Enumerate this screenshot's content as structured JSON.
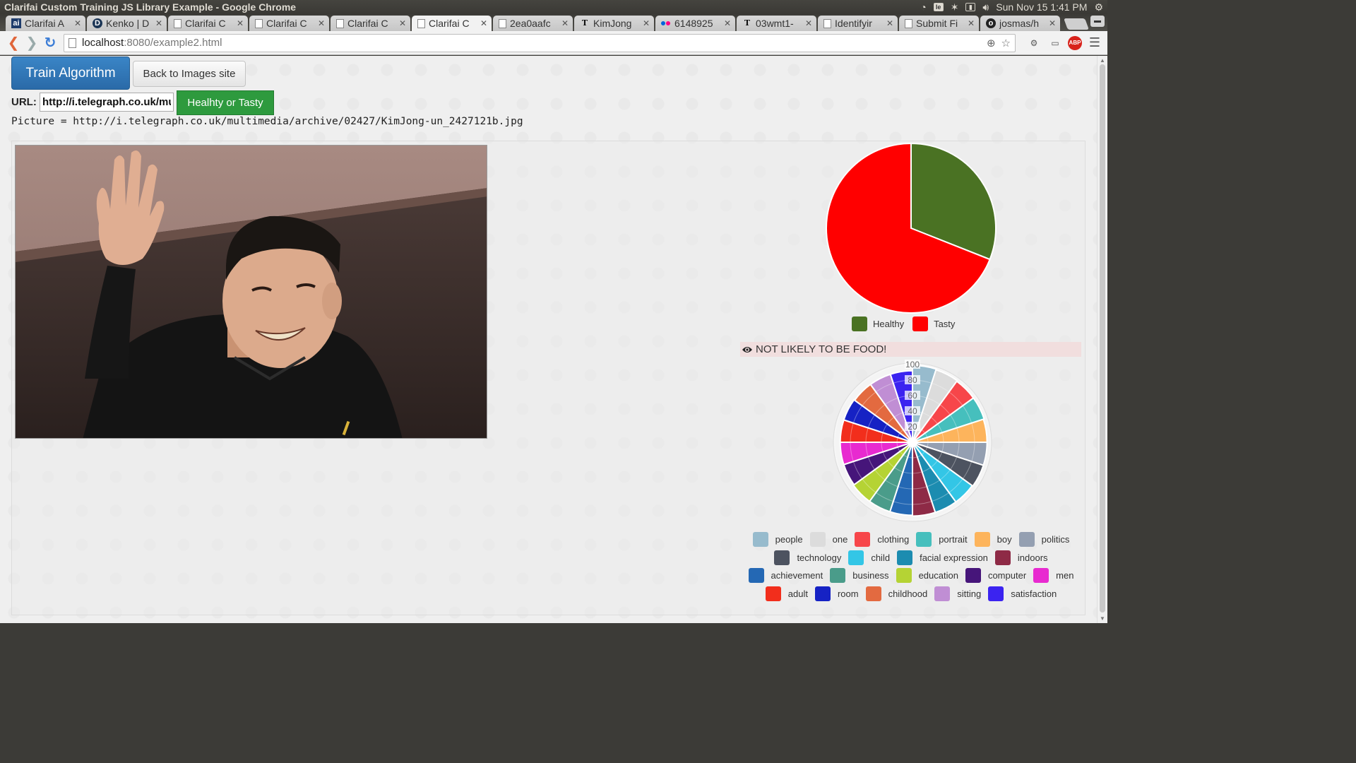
{
  "os": {
    "window_title": "Clarifai Custom Training JS Library Example - Google Chrome",
    "clock": "Sun Nov 15  1:41 PM"
  },
  "tabs": [
    {
      "label": "Clarifai A",
      "icon": "clarifai-icon",
      "active": false
    },
    {
      "label": "Kenko | D",
      "icon": "d-logo-icon",
      "active": false
    },
    {
      "label": "Clarifai C",
      "icon": "page-icon",
      "active": false
    },
    {
      "label": "Clarifai C",
      "icon": "page-icon",
      "active": false
    },
    {
      "label": "Clarifai C",
      "icon": "page-icon",
      "active": false
    },
    {
      "label": "Clarifai C",
      "icon": "page-icon",
      "active": true
    },
    {
      "label": "2ea0aafc",
      "icon": "page-icon",
      "active": false
    },
    {
      "label": "KimJong",
      "icon": "telegraph-icon",
      "active": false
    },
    {
      "label": "6148925",
      "icon": "flickr-icon",
      "active": false
    },
    {
      "label": "03wmt1-",
      "icon": "nyt-icon",
      "active": false
    },
    {
      "label": "Identifyir",
      "icon": "page-icon",
      "active": false
    },
    {
      "label": "Submit Fi",
      "icon": "submit-icon",
      "active": false
    },
    {
      "label": "josmas/h",
      "icon": "github-icon",
      "active": false
    }
  ],
  "address_bar": {
    "host": "localhost",
    "path": ":8080/example2.html"
  },
  "page": {
    "train_button": "Train Algorithm",
    "back_button": "Back to Images site",
    "url_label": "URL:",
    "url_value": "http://i.telegraph.co.uk/multimedia/archive/02427/KimJong-un_2427121b.jpg",
    "classify_button": "Healhty or Tasty",
    "picture_text": "Picture = http://i.telegraph.co.uk/multimedia/archive/02427/KimJong-un_2427121b.jpg",
    "alert_text": "NOT LIKELY TO BE FOOD!"
  },
  "chart_data": [
    {
      "type": "pie",
      "series": [
        {
          "name": "Healthy",
          "value": 0.31,
          "color": "#4a7223"
        },
        {
          "name": "Tasty",
          "value": 0.69,
          "color": "#ff0000"
        }
      ],
      "legend": "bottom"
    },
    {
      "type": "polarArea",
      "scale_ticks": [
        20,
        40,
        60,
        80,
        100
      ],
      "scale_max": 100,
      "series": [
        {
          "name": "people",
          "value": 99,
          "color": "#97bbcd"
        },
        {
          "name": "one",
          "value": 98,
          "color": "#dcdcdc"
        },
        {
          "name": "clothing",
          "value": 97,
          "color": "#f7464a"
        },
        {
          "name": "portrait",
          "value": 97,
          "color": "#46bfbd"
        },
        {
          "name": "boy",
          "value": 96,
          "color": "#fdb45c"
        },
        {
          "name": "politics",
          "value": 96,
          "color": "#949fb1"
        },
        {
          "name": "technology",
          "value": 96,
          "color": "#4d5360"
        },
        {
          "name": "child",
          "value": 95,
          "color": "#33c6e6"
        },
        {
          "name": "facial expression",
          "value": 95,
          "color": "#1c8cb0"
        },
        {
          "name": "indoors",
          "value": 95,
          "color": "#8e2a46"
        },
        {
          "name": "achievement",
          "value": 94,
          "color": "#2468b4"
        },
        {
          "name": "business",
          "value": 94,
          "color": "#4a9c8a"
        },
        {
          "name": "education",
          "value": 94,
          "color": "#b5d334"
        },
        {
          "name": "computer",
          "value": 93,
          "color": "#46157a"
        },
        {
          "name": "men",
          "value": 93,
          "color": "#e82ad0"
        },
        {
          "name": "adult",
          "value": 93,
          "color": "#f22e1c"
        },
        {
          "name": "room",
          "value": 93,
          "color": "#1622c4"
        },
        {
          "name": "childhood",
          "value": 92,
          "color": "#e36a40"
        },
        {
          "name": "sitting",
          "value": 92,
          "color": "#c08ed4"
        },
        {
          "name": "satisfaction",
          "value": 92,
          "color": "#3b23f0"
        }
      ],
      "legend": "bottom"
    }
  ]
}
